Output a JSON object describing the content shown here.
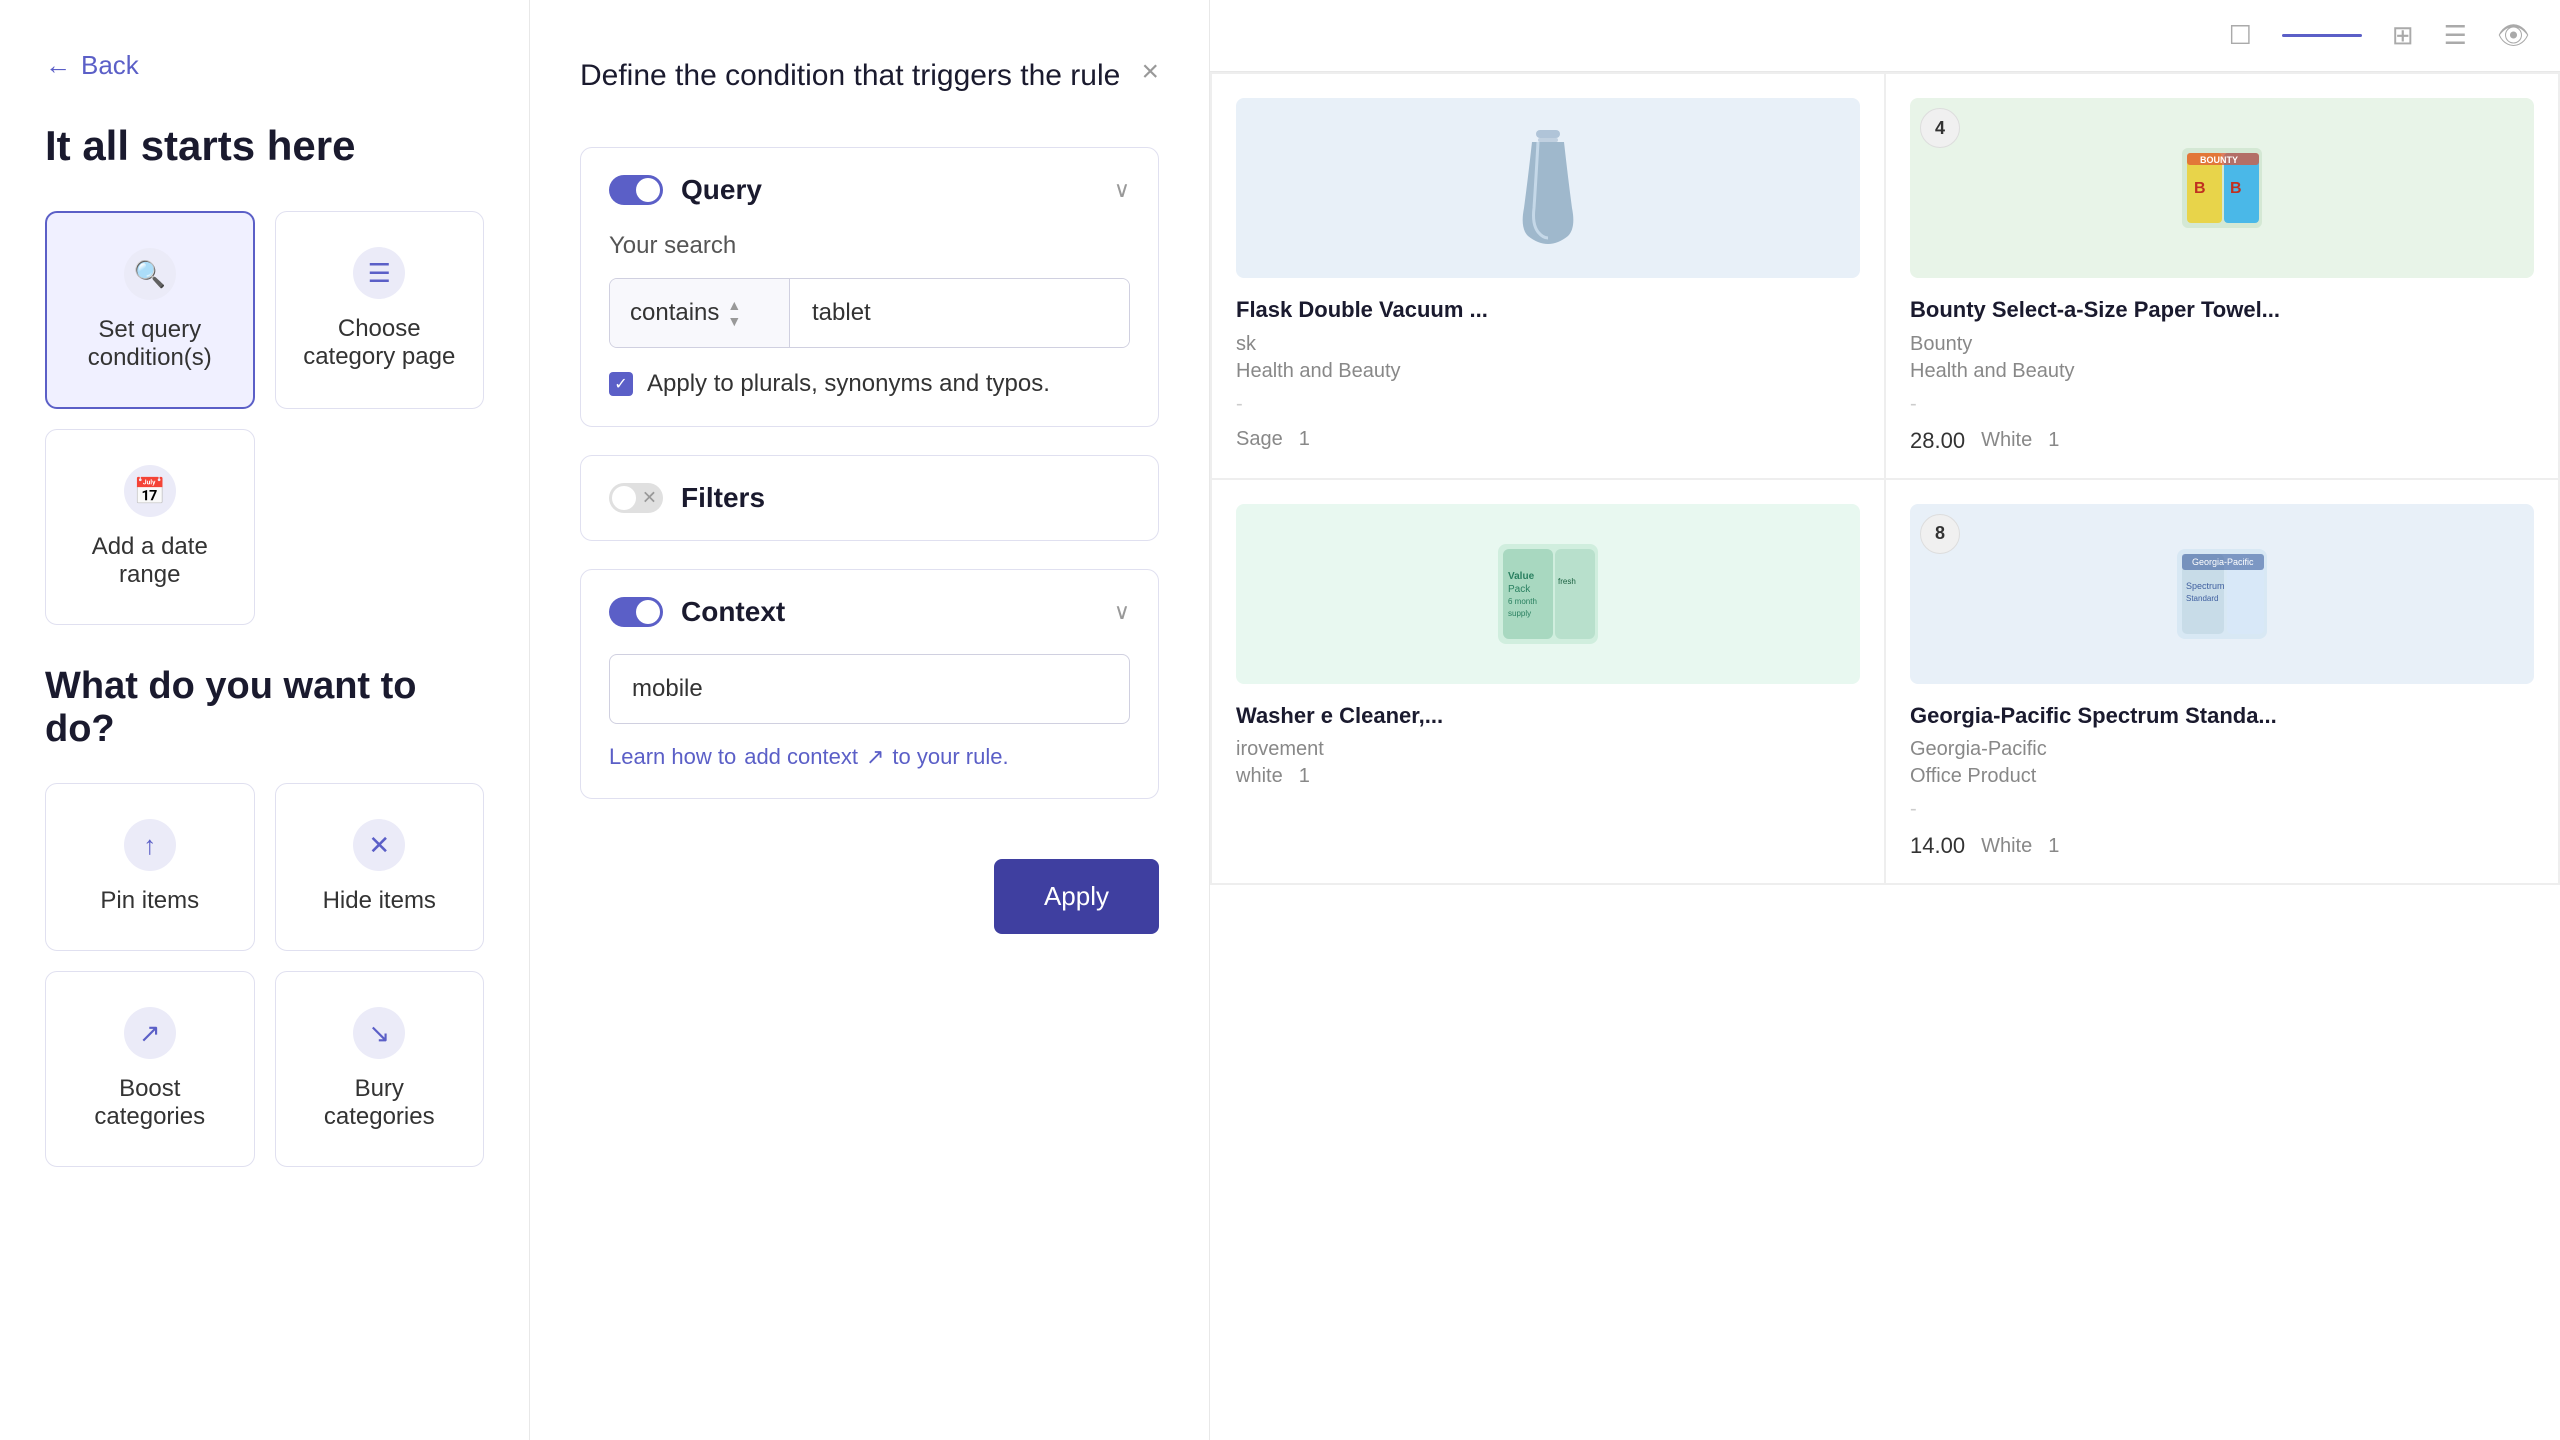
{
  "left": {
    "back_label": "Back",
    "section1_title": "It all starts here",
    "cards_top": [
      {
        "id": "set-query",
        "label": "Set query condition(s)",
        "icon": "🔍",
        "selected": true
      },
      {
        "id": "choose-category",
        "label": "Choose category page",
        "icon": "☰",
        "selected": false
      }
    ],
    "cards_bottom_single": [
      {
        "id": "add-date-range",
        "label": "Add a date range",
        "icon": "📅",
        "selected": false
      }
    ],
    "section2_title": "What do you want to do?",
    "action_cards": [
      {
        "id": "pin-items",
        "label": "Pin items",
        "icon": "↑",
        "selected": false
      },
      {
        "id": "hide-items",
        "label": "Hide items",
        "icon": "✕",
        "selected": false
      },
      {
        "id": "boost-categories",
        "label": "Boost categories",
        "icon": "↗",
        "selected": false
      },
      {
        "id": "bury-categories",
        "label": "Bury categories",
        "icon": "↘",
        "selected": false
      }
    ]
  },
  "modal": {
    "title": "Define the condition that triggers the rule",
    "close_label": "×",
    "query_section": {
      "title": "Query",
      "toggle_on": true,
      "your_search_label": "Your search",
      "select_value": "contains",
      "search_value": "tablet",
      "checkbox_label": "Apply to plurals, synonyms and typos.",
      "checkbox_checked": true
    },
    "filters_section": {
      "title": "Filters",
      "toggle_on": false
    },
    "context_section": {
      "title": "Context",
      "toggle_on": true,
      "input_value": "mobile",
      "link_prefix": "Learn how to ",
      "link_text": "add context",
      "link_suffix": " to your rule."
    },
    "apply_label": "Apply"
  },
  "right": {
    "toolbar": {
      "checkbox_icon": "☐",
      "grid_icon": "⊞",
      "list_icon": "☰",
      "eye_icon": "👁"
    },
    "products": [
      {
        "id": "flask",
        "name": "Flask Double Vacuum ...",
        "brand": "sk",
        "category": "Health and Beauty",
        "dash": "-",
        "price": "",
        "color": "Sage",
        "count": "1",
        "badge": "",
        "img_type": "flask"
      },
      {
        "id": "bounty",
        "name": "Bounty Select-a-Size Paper Towel...",
        "brand": "Bounty",
        "category": "Health and Beauty",
        "dash": "-",
        "price": "28.00",
        "color": "White",
        "count": "1",
        "badge": "4",
        "img_type": "bounty"
      },
      {
        "id": "washer",
        "name": "Washer e Cleaner,...",
        "brand": "irovement",
        "category": "",
        "dash": "",
        "price": "",
        "color": "white",
        "count": "1",
        "badge": "",
        "img_type": "washer"
      },
      {
        "id": "spectrum",
        "name": "Georgia-Pacific Spectrum Standa...",
        "brand": "Georgia-Pacific",
        "category": "Office Product",
        "dash": "-",
        "price": "14.00",
        "color": "White",
        "count": "1",
        "badge": "8",
        "img_type": "spectrum"
      }
    ]
  }
}
